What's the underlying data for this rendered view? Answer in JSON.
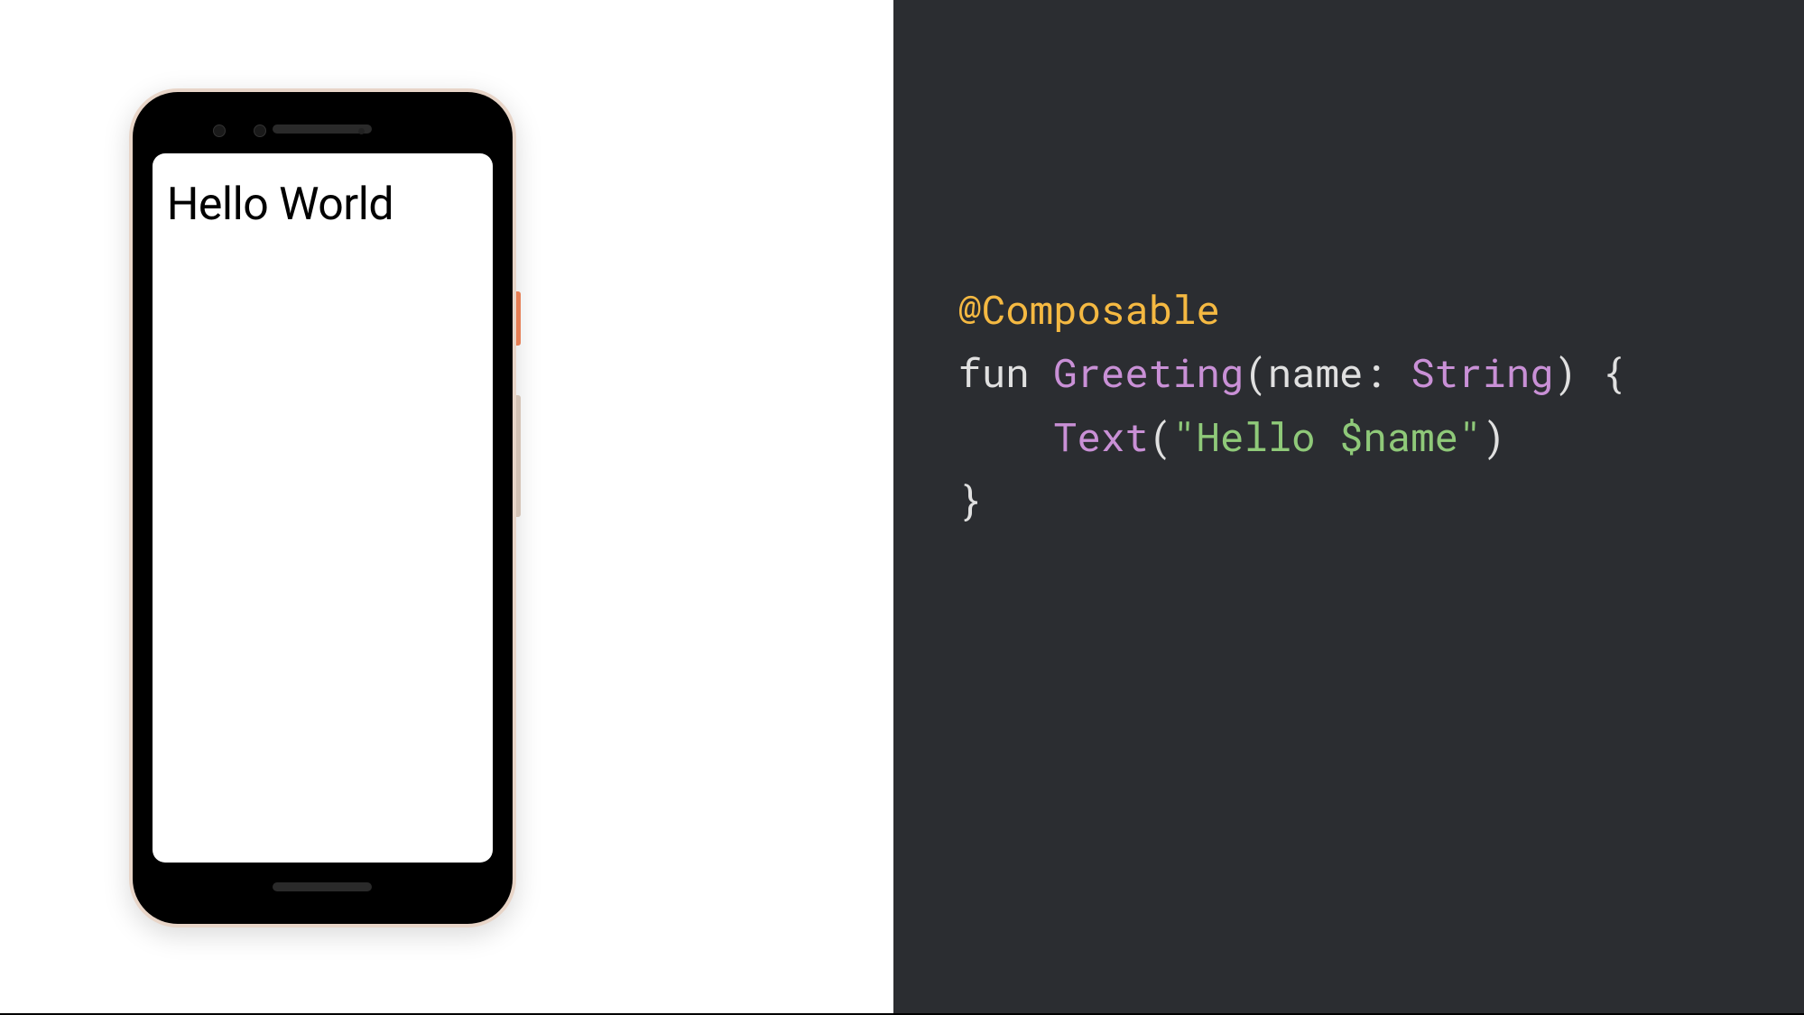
{
  "phone": {
    "screen_text": "Hello World"
  },
  "code": {
    "annotation": "@Composable",
    "keyword_fun": "fun",
    "function_name": "Greeting",
    "paren_open": "(",
    "param_name": "name",
    "colon": ": ",
    "param_type": "String",
    "paren_close": ")",
    "brace_open": " {",
    "indent": "    ",
    "call_name": "Text",
    "call_paren_open": "(",
    "string_literal": "\"Hello $name\"",
    "call_paren_close": ")",
    "brace_close": "}"
  },
  "colors": {
    "code_bg": "#2b2d31",
    "annotation": "#f5b942",
    "identifier": "#c990d6",
    "string": "#8fc979",
    "default": "#e0e0e0",
    "power_button": "#e67e54",
    "phone_body": "#e8d5c8"
  }
}
